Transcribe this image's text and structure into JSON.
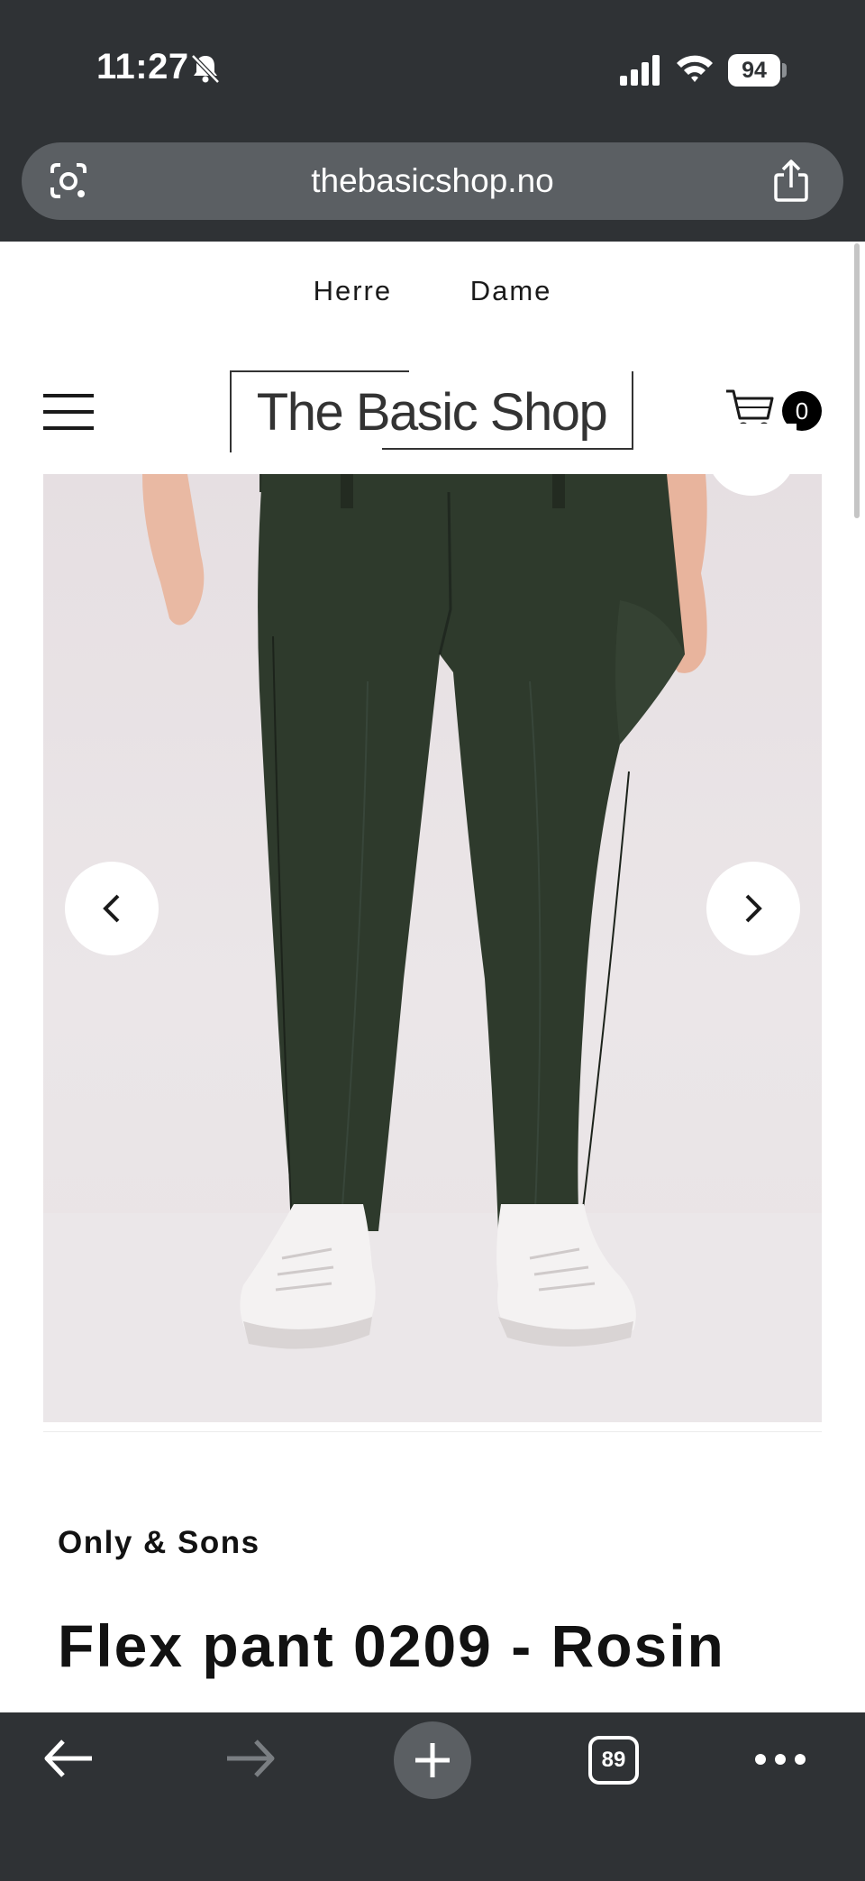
{
  "status_bar": {
    "time": "11:27",
    "battery_level": "94",
    "icons": [
      "bell-slash-icon",
      "cellular-signal-icon",
      "wifi-icon",
      "battery-icon"
    ]
  },
  "browser": {
    "url": "thebasicshop.no",
    "open_tabs_count": "89",
    "icons": [
      "google-lens-icon",
      "share-icon",
      "back-arrow-icon",
      "forward-arrow-icon",
      "new-tab-plus-icon",
      "tabs-icon",
      "more-dots-icon"
    ]
  },
  "site": {
    "nav": {
      "herre": "Herre",
      "dame": "Dame"
    },
    "logo_text": "The Basic Shop",
    "cart_count": "0",
    "icons": [
      "hamburger-menu-icon",
      "cart-icon"
    ]
  },
  "product": {
    "image_alt": "Olive green flex pants worn with white sneakers",
    "brand": "Only & Sons",
    "title": "Flex pant 0209 - Rosin",
    "carousel": {
      "prev_icon": "chevron-left-icon",
      "next_icon": "chevron-right-icon"
    }
  },
  "colors": {
    "chrome_bg": "#2f3235",
    "url_bar_bg": "#5b5f63",
    "pants": "#2e3a2c",
    "text": "#121212"
  }
}
